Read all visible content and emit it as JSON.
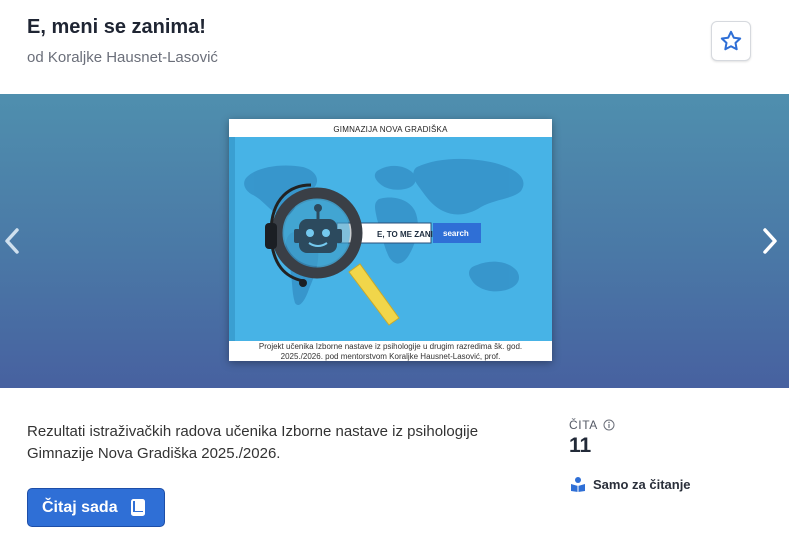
{
  "book": {
    "title": "E, meni se zanima!",
    "author": "od Koraljke Hausnet-Lasović",
    "description": "Rezultati istraživačkih radova učenika Izborne nastave iz psihologije Gimnazije Nova Gradiška 2025./2026."
  },
  "cover": {
    "header_text": "GIMNAZIJA  NOVA GRADIŠKA",
    "search_text": "E, TO ME ZANIMA!",
    "search_button": "search",
    "footer_line1": "Projekt učenika  Izborne nastave iz psihologije u drugim razredima šk. god.",
    "footer_line2": "2025./2026. pod mentorstvom  Koraljke  Hausnet-Lasović, prof."
  },
  "actions": {
    "read_label": "Čitaj sada"
  },
  "stats": {
    "reads_label": "ČITA",
    "reads_value": "11",
    "readonly_label": "Samo za čitanje"
  },
  "icons": {
    "favorite": "star-outline-icon",
    "read": "book-icon",
    "info": "info-icon",
    "readonly": "reader-icon"
  },
  "colors": {
    "accent": "#2f6fd6",
    "cover_blue": "#47b3e6"
  }
}
